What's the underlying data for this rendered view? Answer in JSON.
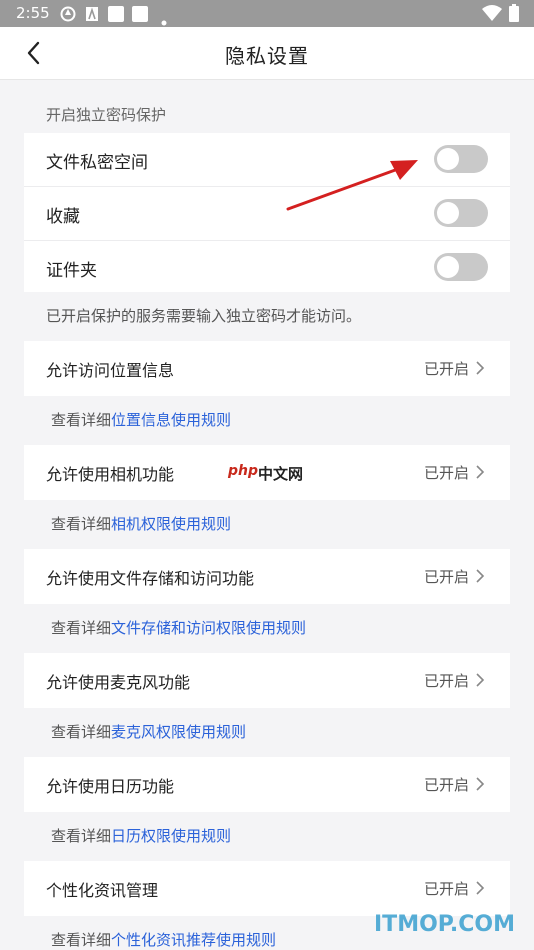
{
  "status_bar": {
    "time": "2:55"
  },
  "header": {
    "title": "隐私设置",
    "back_icon": "chevron-left-icon"
  },
  "password_section": {
    "label": "开启独立密码保护",
    "items": [
      {
        "label": "文件私密空间",
        "enabled": false
      },
      {
        "label": "收藏",
        "enabled": false
      },
      {
        "label": "证件夹",
        "enabled": false
      }
    ],
    "note": "已开启保护的服务需要输入独立密码才能访问。"
  },
  "permissions": [
    {
      "label": "允许访问位置信息",
      "status": "已开启",
      "detail_prefix": "查看详细",
      "detail_link": "位置信息使用规则"
    },
    {
      "label": "允许使用相机功能",
      "status": "已开启",
      "detail_prefix": "查看详细",
      "detail_link": "相机权限使用规则"
    },
    {
      "label": "允许使用文件存储和访问功能",
      "status": "已开启",
      "detail_prefix": "查看详细",
      "detail_link": "文件存储和访问权限使用规则"
    },
    {
      "label": "允许使用麦克风功能",
      "status": "已开启",
      "detail_prefix": "查看详细",
      "detail_link": "麦克风权限使用规则"
    },
    {
      "label": "允许使用日历功能",
      "status": "已开启",
      "detail_prefix": "查看详细",
      "detail_link": "日历权限使用规则"
    },
    {
      "label": "个性化资讯管理",
      "status": "已开启",
      "detail_prefix": "查看详细",
      "detail_link": "个性化资讯推荐使用规则"
    }
  ],
  "watermarks": {
    "php_logo": "php",
    "php_cn": "中文网",
    "site": "ITMOP.COM"
  },
  "colors": {
    "link": "#2b62d9",
    "toggle_off": "#c9c9c9",
    "arrow": "#d42020"
  }
}
